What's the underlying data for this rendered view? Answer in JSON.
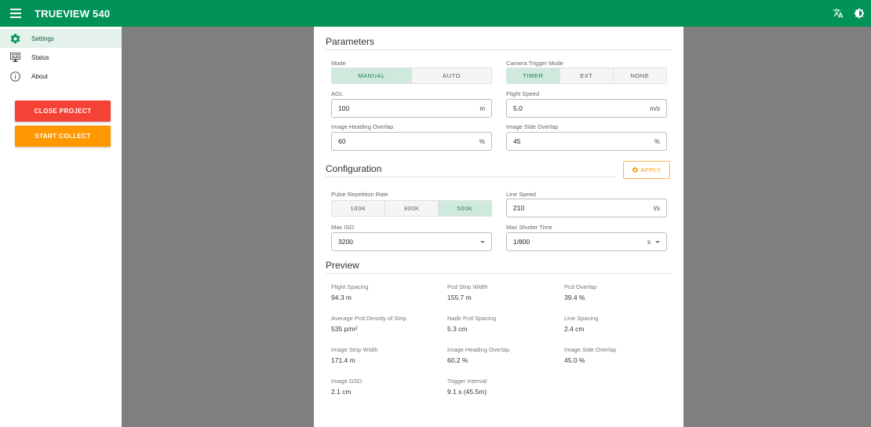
{
  "appbar": {
    "title": "TRUEVIEW 540",
    "menu_icon": "hamburger-menu-icon",
    "translate_icon": "translate-icon",
    "contrast_icon": "contrast-icon"
  },
  "colors": {
    "primary": "#009257",
    "danger": "#f44336",
    "warning": "#ff9800",
    "selected_bg": "#cfeadd"
  },
  "sidebar": {
    "items": [
      {
        "label": "Settings",
        "icon": "gear-icon",
        "active": true
      },
      {
        "label": "Status",
        "icon": "monitor-icon",
        "active": false
      },
      {
        "label": "About",
        "icon": "info-icon",
        "active": false
      }
    ],
    "close_project": "CLOSE PROJECT",
    "start_collect": "START COLLECT"
  },
  "parameters": {
    "title": "Parameters",
    "mode": {
      "label": "Mode",
      "options": [
        "MANUAL",
        "AUTO"
      ],
      "selected": "MANUAL"
    },
    "camera_trigger_mode": {
      "label": "Camera Trigger Mode",
      "options": [
        "TIMER",
        "EXT",
        "NONE"
      ],
      "selected": "TIMER"
    },
    "agl": {
      "label": "AGL",
      "value": "100",
      "unit": "m"
    },
    "flight_speed": {
      "label": "Flight Speed",
      "value": "5.0",
      "unit": "m/s"
    },
    "image_heading_overlap": {
      "label": "Image Heading Overlap",
      "value": "60",
      "unit": "%"
    },
    "image_side_overlap": {
      "label": "Image Side Overlap",
      "value": "45",
      "unit": "%"
    }
  },
  "configuration": {
    "title": "Configuration",
    "apply": "APPLY",
    "pulse_repetition_rate": {
      "label": "Pulse Repetition Rate",
      "options": [
        "100K",
        "300K",
        "500K"
      ],
      "selected": "500K"
    },
    "line_speed": {
      "label": "Line Speed",
      "value": "210",
      "unit": "l/s"
    },
    "max_iso": {
      "label": "Max ISO",
      "value": "3200"
    },
    "max_shutter_time": {
      "label": "Max Shutter Time",
      "value": "1/800",
      "unit": "s"
    }
  },
  "preview": {
    "title": "Preview",
    "items": [
      {
        "label": "Flight Spacing",
        "value": "94.3 m"
      },
      {
        "label": "Pcd Strip Width",
        "value": "155.7 m"
      },
      {
        "label": "Pcd Overlap",
        "value": "39.4 %"
      },
      {
        "label": "Average Pcd Density of Strip",
        "value": "535 p/m²"
      },
      {
        "label": "Nadir Pcd Spacing",
        "value": "5.3 cm"
      },
      {
        "label": "Line Spacing",
        "value": "2.4 cm"
      },
      {
        "label": "Image Strip Width",
        "value": "171.4 m"
      },
      {
        "label": "Image Heading Overlap",
        "value": "60.2 %"
      },
      {
        "label": "Image Side Overlap",
        "value": "45.0 %"
      },
      {
        "label": "Image GSD",
        "value": "2.1 cm"
      },
      {
        "label": "Trigger Interval",
        "value": "9.1 s (45.5m)"
      }
    ]
  }
}
